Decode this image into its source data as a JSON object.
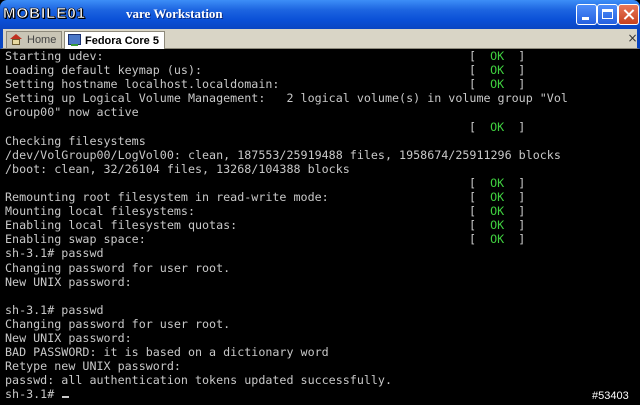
{
  "window": {
    "title": "vare Workstation",
    "watermark": "MOBILE01"
  },
  "tabs": [
    {
      "label": "Home",
      "icon": "home-icon"
    },
    {
      "label": "Fedora Core 5",
      "icon": "vm-icon"
    }
  ],
  "tab_close_glyph": "×",
  "console": {
    "lines": [
      "Starting udev:",
      "Loading default keymap (us):",
      "Setting hostname localhost.localdomain:",
      "Setting up Logical Volume Management:   2 logical volume(s) in volume group \"Vol",
      "Group00\" now active",
      "",
      "Checking filesystems",
      "/dev/VolGroup00/LogVol00: clean, 187553/25919488 files, 1958674/25911296 blocks",
      "/boot: clean, 32/26104 files, 13268/104388 blocks",
      "",
      "Remounting root filesystem in read-write mode:",
      "Mounting local filesystems:",
      "Enabling local filesystem quotas:",
      "Enabling swap space:",
      "sh-3.1# passwd",
      "Changing password for user root.",
      "New UNIX password:",
      "",
      "sh-3.1# passwd",
      "Changing password for user root.",
      "New UNIX password:",
      "BAD PASSWORD: it is based on a dictionary word",
      "Retype new UNIX password:",
      "passwd: all authentication tokens updated successfully.",
      "sh-3.1# "
    ],
    "status_open": "[  ",
    "status_ok": "OK",
    "status_close": "  ]",
    "ok_color": "#3fcf3f"
  },
  "image_mark": "#53403"
}
